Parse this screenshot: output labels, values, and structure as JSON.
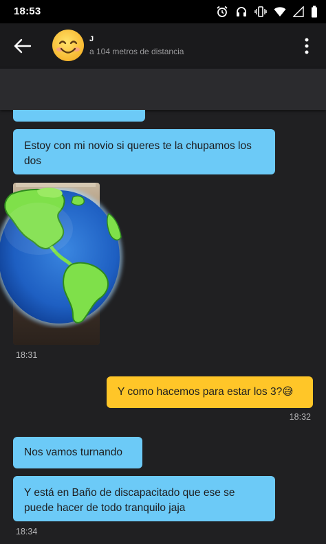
{
  "status_bar": {
    "time": "18:53",
    "icons": [
      "alarm-icon",
      "headphones-icon",
      "vibrate-icon",
      "wifi-icon",
      "signal-icon",
      "battery-icon"
    ]
  },
  "header": {
    "back_icon": "arrow-left-icon",
    "avatar_icon": "smiling-face-emoji",
    "contact_name": "J",
    "distance": "a 104 metros de distancia",
    "menu_icon": "more-vertical-icon"
  },
  "messages": [
    {
      "id": "m0",
      "direction": "incoming",
      "text": ""
    },
    {
      "id": "m1",
      "direction": "incoming",
      "text": "Estoy con mi novio si queres te la chupamos los dos"
    },
    {
      "id": "m2",
      "direction": "incoming",
      "type": "photo",
      "overlay": "globe-emoji",
      "time": "18:31"
    },
    {
      "id": "m3",
      "direction": "outgoing",
      "text": "Y como hacemos para estar los 3?😅",
      "time": "18:32"
    },
    {
      "id": "m4",
      "direction": "incoming",
      "text": "Nos vamos turnando"
    },
    {
      "id": "m5",
      "direction": "incoming",
      "text": "Y está en Baño de discapacitado que ese se puede hacer de todo tranquilo jaja",
      "time": "18:34"
    }
  ],
  "colors": {
    "background": "#202022",
    "incoming_bubble": "#6ccaf7",
    "outgoing_bubble": "#ffc628",
    "app_bar": "#1a1a1c"
  }
}
